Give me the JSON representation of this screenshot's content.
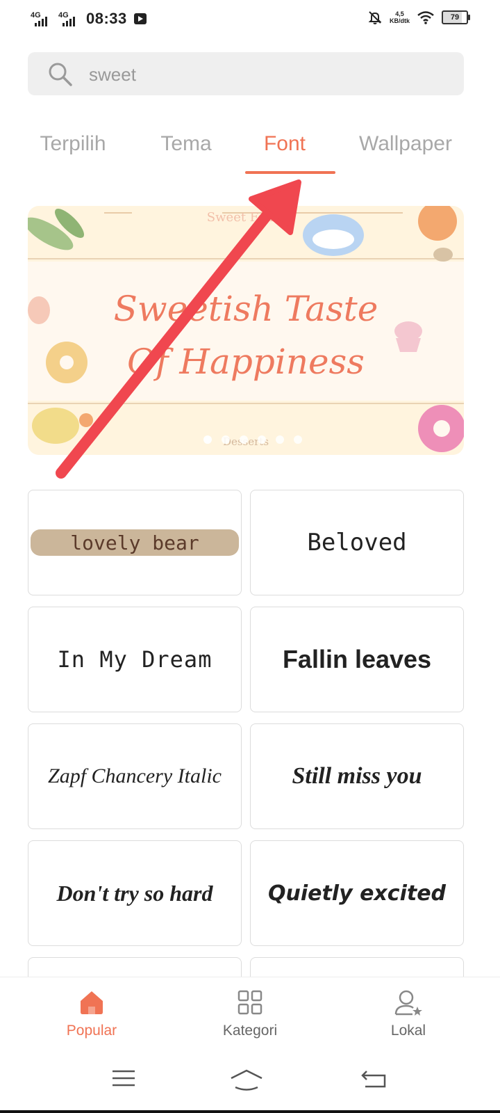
{
  "status_bar": {
    "network_1": "4G",
    "network_2": "4G",
    "time": "08:33",
    "speed_value": "4,5",
    "speed_unit": "KB/dtk",
    "battery": "79"
  },
  "search": {
    "value": "sweet",
    "icon": "search-icon"
  },
  "tabs": [
    {
      "label": "Terpilih",
      "active": false
    },
    {
      "label": "Tema",
      "active": false
    },
    {
      "label": "Font",
      "active": true
    },
    {
      "label": "Wallpaper",
      "active": false
    }
  ],
  "banner": {
    "kicker": "Sweet Fonts",
    "headline_line1": "Sweetish Taste",
    "headline_line2": "Of Happiness",
    "footer": "Desserts",
    "slide_count": 6,
    "active_slide": 1
  },
  "fonts": [
    {
      "label": "lovely bear"
    },
    {
      "label": "Beloved"
    },
    {
      "label": "In My Dream"
    },
    {
      "label": "Fallin leaves"
    },
    {
      "label": "Zapf Chancery Italic"
    },
    {
      "label": "Still miss you"
    },
    {
      "label": "Don't try so hard"
    },
    {
      "label": "Quietly excited"
    }
  ],
  "bottom_nav": [
    {
      "label": "Popular",
      "icon": "home-icon",
      "active": true
    },
    {
      "label": "Kategori",
      "icon": "grid-icon",
      "active": false
    },
    {
      "label": "Lokal",
      "icon": "user-star-icon",
      "active": false
    }
  ],
  "colors": {
    "accent": "#f07354",
    "annotation_arrow": "#f0474f",
    "search_bg": "#efefef",
    "inactive_text": "#a8a8a8"
  }
}
